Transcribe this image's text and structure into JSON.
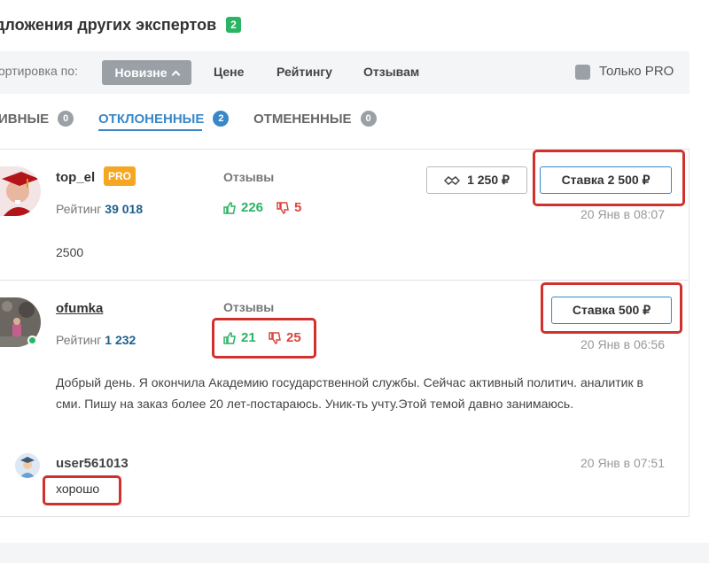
{
  "header": {
    "title": "дложения других экспертов",
    "count": "2"
  },
  "sort": {
    "label": "ортировка по:",
    "active": "Новизне",
    "options": [
      "Цене",
      "Рейтингу",
      "Отзывам"
    ],
    "pro_only_label": "Только PRO"
  },
  "tabs": [
    {
      "label": "ИВНЫЕ",
      "count": "0"
    },
    {
      "label": "ОТКЛОНЕННЫЕ",
      "count": "2"
    },
    {
      "label": "ОТМЕНЕННЫЕ",
      "count": "0"
    }
  ],
  "bids": [
    {
      "username": "top_el",
      "pro_badge": "PRO",
      "rating_label": "Рейтинг",
      "rating_value": "39 018",
      "reviews_label": "Отзывы",
      "likes": "226",
      "dislikes": "5",
      "deal_button": "1 250 ₽",
      "bid_button": "Ставка 2 500 ₽",
      "date": "20 Янв в 08:07",
      "message": "2500"
    },
    {
      "username": "ofumka",
      "rating_label": "Рейтинг",
      "rating_value": "1 232",
      "reviews_label": "Отзывы",
      "likes": "21",
      "dislikes": "25",
      "bid_button": "Ставка 500 ₽",
      "date": "20 Янв в 06:56",
      "message": "Добрый день. Я окончила Академию государственной службы. Сейчас активный политич. аналитик в сми. Пишу на заказ более 20 лет-постараюсь. Уник-ть учту.Этой темой давно занимаюсь.",
      "comment": {
        "username": "user561013",
        "date": "20 Янв в 07:51",
        "text": "хорошо"
      }
    }
  ],
  "colors": {
    "accent": "#3a87c8",
    "positive": "#2ab463",
    "negative": "#d9463e",
    "pro": "#f5a623",
    "highlight": "#d0312d"
  }
}
